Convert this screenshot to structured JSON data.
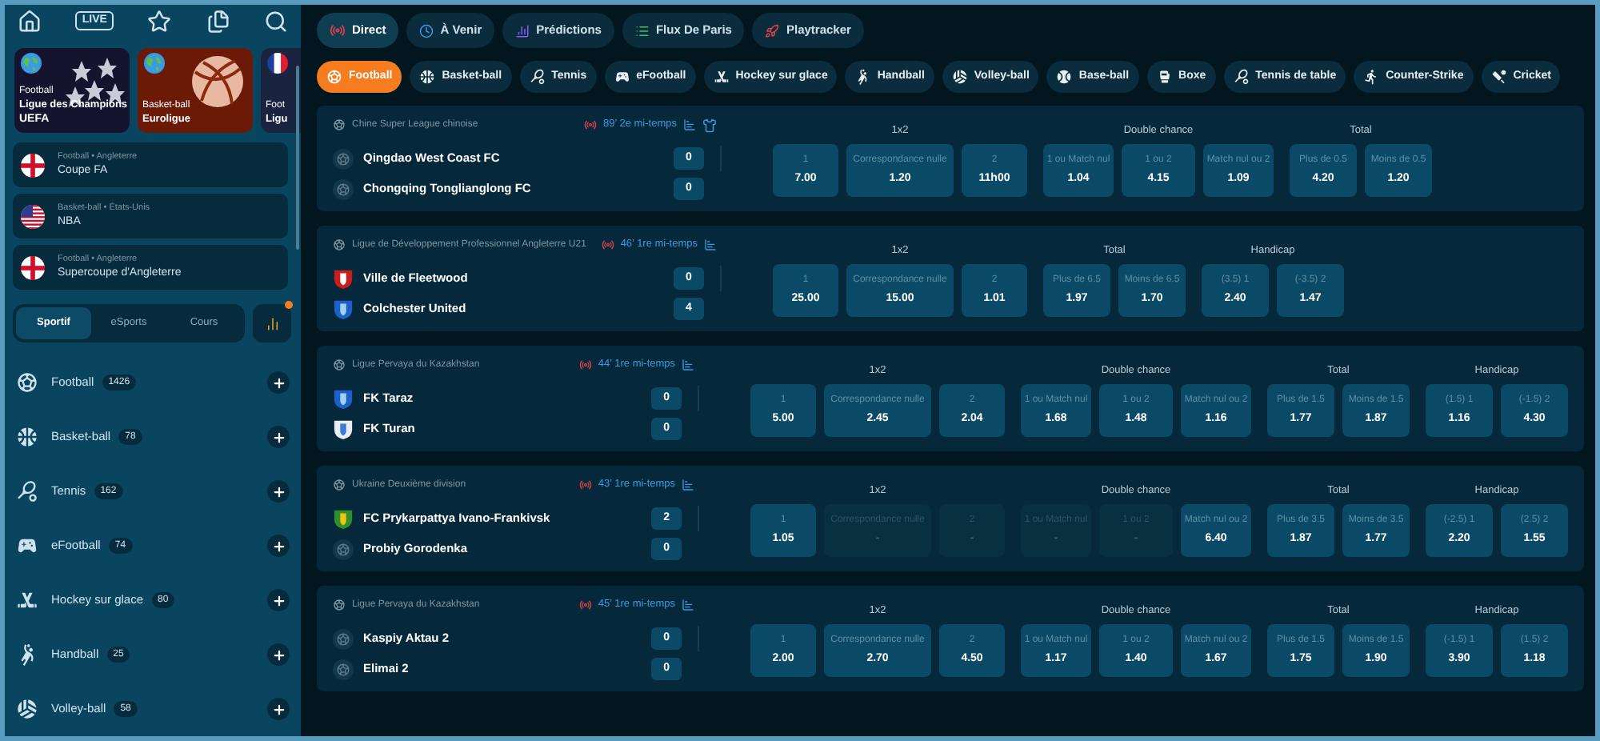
{
  "top_icons": {
    "live_label": "LIVE"
  },
  "banners": [
    {
      "sport": "Football",
      "title": "Ligue des Champions",
      "subtitle": "UEFA"
    },
    {
      "sport": "Basket-ball",
      "title": "Euroligue"
    },
    {
      "sport": "Foot",
      "title": "Ligu"
    }
  ],
  "competitions": [
    {
      "meta": "Football • Angleterre",
      "title": "Coupe FA"
    },
    {
      "meta": "Basket-ball • États-Unis",
      "title": "NBA"
    },
    {
      "meta": "Football • Angleterre",
      "title": "Supercoupe d'Angleterre"
    }
  ],
  "mode_tabs": [
    {
      "label": "Sportif",
      "selected": true
    },
    {
      "label": "eSports",
      "selected": false
    },
    {
      "label": "Cours",
      "selected": false
    }
  ],
  "stats_button": {
    "notification": true
  },
  "sports_list": [
    {
      "name": "Football",
      "count": "1426"
    },
    {
      "name": "Basket-ball",
      "count": "78"
    },
    {
      "name": "Tennis",
      "count": "162"
    },
    {
      "name": "eFootball",
      "count": "74"
    },
    {
      "name": "Hockey sur glace",
      "count": "80"
    },
    {
      "name": "Handball",
      "count": "25"
    },
    {
      "name": "Volley-ball",
      "count": "58"
    }
  ],
  "nav_tabs": [
    {
      "label": "Direct",
      "selected": true
    },
    {
      "label": "À Venir",
      "selected": false
    },
    {
      "label": "Prédictions",
      "selected": false
    },
    {
      "label": "Flux De Paris",
      "selected": false
    },
    {
      "label": "Playtracker",
      "selected": false
    }
  ],
  "sport_filters": [
    {
      "label": "Football",
      "selected": true
    },
    {
      "label": "Basket-ball",
      "selected": false
    },
    {
      "label": "Tennis",
      "selected": false
    },
    {
      "label": "eFootball",
      "selected": false
    },
    {
      "label": "Hockey sur glace",
      "selected": false
    },
    {
      "label": "Handball",
      "selected": false
    },
    {
      "label": "Volley-ball",
      "selected": false
    },
    {
      "label": "Base-ball",
      "selected": false
    },
    {
      "label": "Boxe",
      "selected": false
    },
    {
      "label": "Tennis de table",
      "selected": false
    },
    {
      "label": "Counter-Strike",
      "selected": false
    },
    {
      "label": "Cricket",
      "selected": false
    }
  ],
  "matches": [
    {
      "league": "Chine Super League chinoise",
      "minute": "89’",
      "period": "2e mi-temps",
      "jersey": true,
      "teams": [
        {
          "name": "Qingdao West Coast FC",
          "score": "0"
        },
        {
          "name": "Chongqing Tonglianglong FC",
          "score": "0"
        }
      ],
      "markets": [
        {
          "title": "1x2",
          "odds": [
            {
              "label": "1",
              "value": "7.00",
              "disabled": false
            },
            {
              "label": "Correspondance nulle",
              "value": "1.20",
              "disabled": false
            },
            {
              "label": "2",
              "value": "11h00",
              "disabled": false
            }
          ]
        },
        {
          "title": "Double chance",
          "odds": [
            {
              "label": "1 ou Match nul",
              "value": "1.04",
              "disabled": false
            },
            {
              "label": "1 ou 2",
              "value": "4.15",
              "disabled": false
            },
            {
              "label": "Match nul ou 2",
              "value": "1.09",
              "disabled": false
            }
          ]
        },
        {
          "title": "Total",
          "odds": [
            {
              "label": "Plus de 0.5",
              "value": "4.20",
              "disabled": false
            },
            {
              "label": "Moins de 0.5",
              "value": "1.20",
              "disabled": false
            }
          ]
        }
      ]
    },
    {
      "league": "Ligue de Développement Professionnel Angleterre U21",
      "minute": "46’",
      "period": "1re mi-temps",
      "jersey": false,
      "teams": [
        {
          "name": "Ville de Fleetwood",
          "score": "0"
        },
        {
          "name": "Colchester United",
          "score": "4"
        }
      ],
      "markets": [
        {
          "title": "1x2",
          "odds": [
            {
              "label": "1",
              "value": "25.00",
              "disabled": false
            },
            {
              "label": "Correspondance nulle",
              "value": "15.00",
              "disabled": false
            },
            {
              "label": "2",
              "value": "1.01",
              "disabled": false
            }
          ]
        },
        {
          "title": "Total",
          "odds": [
            {
              "label": "Plus de 6.5",
              "value": "1.97",
              "disabled": false
            },
            {
              "label": "Moins de 6.5",
              "value": "1.70",
              "disabled": false
            }
          ]
        },
        {
          "title": "Handicap",
          "odds": [
            {
              "label": "(3.5) 1",
              "value": "2.40",
              "disabled": false
            },
            {
              "label": "(-3.5) 2",
              "value": "1.47",
              "disabled": false
            }
          ]
        }
      ]
    },
    {
      "league": "Ligue Pervaya du Kazakhstan",
      "minute": "44’",
      "period": "1re mi-temps",
      "jersey": false,
      "teams": [
        {
          "name": "FK Taraz",
          "score": "0"
        },
        {
          "name": "FK Turan",
          "score": "0"
        }
      ],
      "markets": [
        {
          "title": "1x2",
          "odds": [
            {
              "label": "1",
              "value": "5.00",
              "disabled": false
            },
            {
              "label": "Correspondance nulle",
              "value": "2.45",
              "disabled": false
            },
            {
              "label": "2",
              "value": "2.04",
              "disabled": false
            }
          ]
        },
        {
          "title": "Double chance",
          "odds": [
            {
              "label": "1 ou Match nul",
              "value": "1.68",
              "disabled": false
            },
            {
              "label": "1 ou 2",
              "value": "1.48",
              "disabled": false
            },
            {
              "label": "Match nul ou 2",
              "value": "1.16",
              "disabled": false
            }
          ]
        },
        {
          "title": "Total",
          "odds": [
            {
              "label": "Plus de 1.5",
              "value": "1.77",
              "disabled": false
            },
            {
              "label": "Moins de 1.5",
              "value": "1.87",
              "disabled": false
            }
          ]
        },
        {
          "title": "Handicap",
          "odds": [
            {
              "label": "(1.5) 1",
              "value": "1.16",
              "disabled": false
            },
            {
              "label": "(-1.5) 2",
              "value": "4.30",
              "disabled": false
            }
          ]
        }
      ]
    },
    {
      "league": "Ukraine Deuxième division",
      "minute": "43’",
      "period": "1re mi-temps",
      "jersey": false,
      "teams": [
        {
          "name": "FC Prykarpattya Ivano-Frankivsk",
          "score": "2"
        },
        {
          "name": "Probiy Gorodenka",
          "score": "0"
        }
      ],
      "markets": [
        {
          "title": "1x2",
          "odds": [
            {
              "label": "1",
              "value": "1.05",
              "disabled": false
            },
            {
              "label": "Correspondance nulle",
              "value": "-",
              "disabled": true
            },
            {
              "label": "2",
              "value": "-",
              "disabled": true
            }
          ]
        },
        {
          "title": "Double chance",
          "odds": [
            {
              "label": "1 ou Match nul",
              "value": "-",
              "disabled": true
            },
            {
              "label": "1 ou 2",
              "value": "-",
              "disabled": true
            },
            {
              "label": "Match nul ou 2",
              "value": "6.40",
              "disabled": false
            }
          ]
        },
        {
          "title": "Total",
          "odds": [
            {
              "label": "Plus de 3.5",
              "value": "1.87",
              "disabled": false
            },
            {
              "label": "Moins de 3.5",
              "value": "1.77",
              "disabled": false
            }
          ]
        },
        {
          "title": "Handicap",
          "odds": [
            {
              "label": "(-2.5) 1",
              "value": "2.20",
              "disabled": false
            },
            {
              "label": "(2.5) 2",
              "value": "1.55",
              "disabled": false
            }
          ]
        }
      ]
    },
    {
      "league": "Ligue Pervaya du Kazakhstan",
      "minute": "45’",
      "period": "1re mi-temps",
      "jersey": false,
      "teams": [
        {
          "name": "Kaspiy Aktau 2",
          "score": "0"
        },
        {
          "name": "Elimai 2",
          "score": "0"
        }
      ],
      "markets": [
        {
          "title": "1x2",
          "odds": [
            {
              "label": "1",
              "value": "2.00",
              "disabled": false
            },
            {
              "label": "Correspondance nulle",
              "value": "2.70",
              "disabled": false
            },
            {
              "label": "2",
              "value": "4.50",
              "disabled": false
            }
          ]
        },
        {
          "title": "Double chance",
          "odds": [
            {
              "label": "1 ou Match nul",
              "value": "1.17",
              "disabled": false
            },
            {
              "label": "1 ou 2",
              "value": "1.40",
              "disabled": false
            },
            {
              "label": "Match nul ou 2",
              "value": "1.67",
              "disabled": false
            }
          ]
        },
        {
          "title": "Total",
          "odds": [
            {
              "label": "Plus de 1.5",
              "value": "1.75",
              "disabled": false
            },
            {
              "label": "Moins de 1.5",
              "value": "1.90",
              "disabled": false
            }
          ]
        },
        {
          "title": "Handicap",
          "odds": [
            {
              "label": "(-1.5) 1",
              "value": "3.90",
              "disabled": false
            },
            {
              "label": "(1.5) 2",
              "value": "1.18",
              "disabled": false
            }
          ]
        }
      ]
    }
  ]
}
